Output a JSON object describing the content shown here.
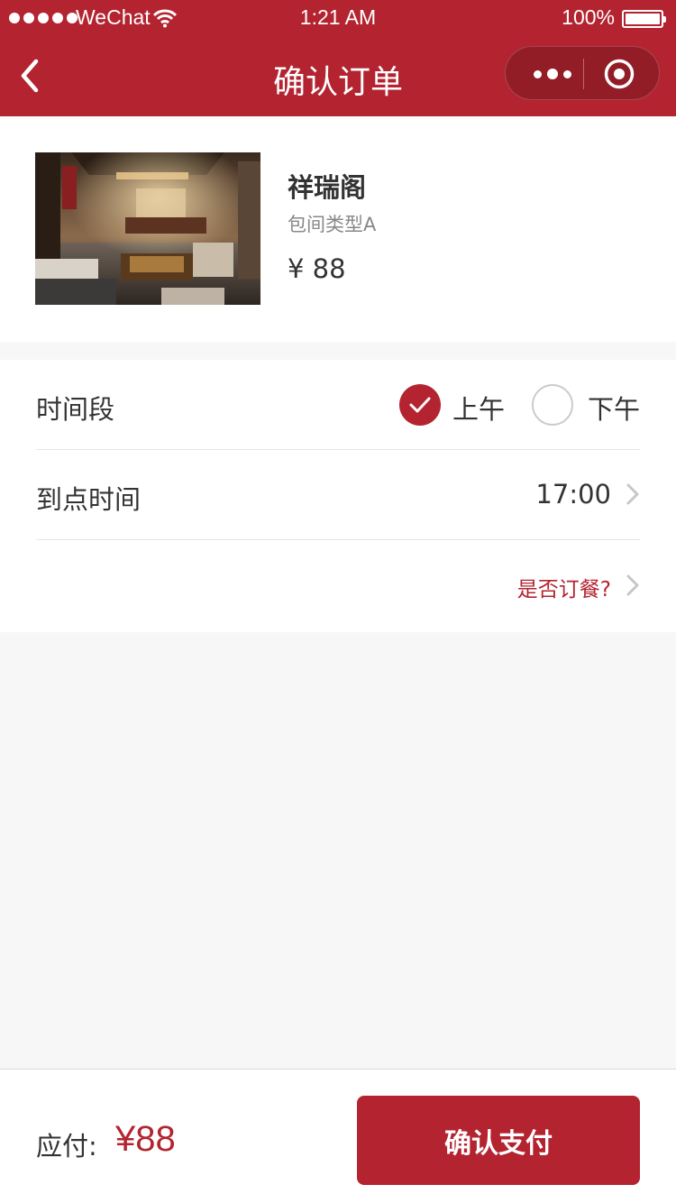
{
  "status_bar": {
    "carrier": "WeChat",
    "time": "1:21 AM",
    "battery": "100%"
  },
  "nav": {
    "title": "确认订单",
    "back_icon": "chevron-left-icon",
    "more_icon": "more-dots-icon",
    "close_icon": "target-circle-icon"
  },
  "product": {
    "name": "祥瑞阁",
    "type": "包间类型A",
    "price": "¥ 88",
    "image": "private-room-photo"
  },
  "form": {
    "time_slot": {
      "label": "时间段",
      "options": [
        {
          "label": "上午",
          "selected": true
        },
        {
          "label": "下午",
          "selected": false
        }
      ]
    },
    "arrival": {
      "label": "到点时间",
      "value": "17:00"
    },
    "meal_link": "是否订餐?"
  },
  "footer": {
    "pay_label": "应付:",
    "pay_amount": "¥88",
    "confirm_button": "确认支付"
  },
  "colors": {
    "brand": "#b32430",
    "background": "#f7f7f7"
  }
}
